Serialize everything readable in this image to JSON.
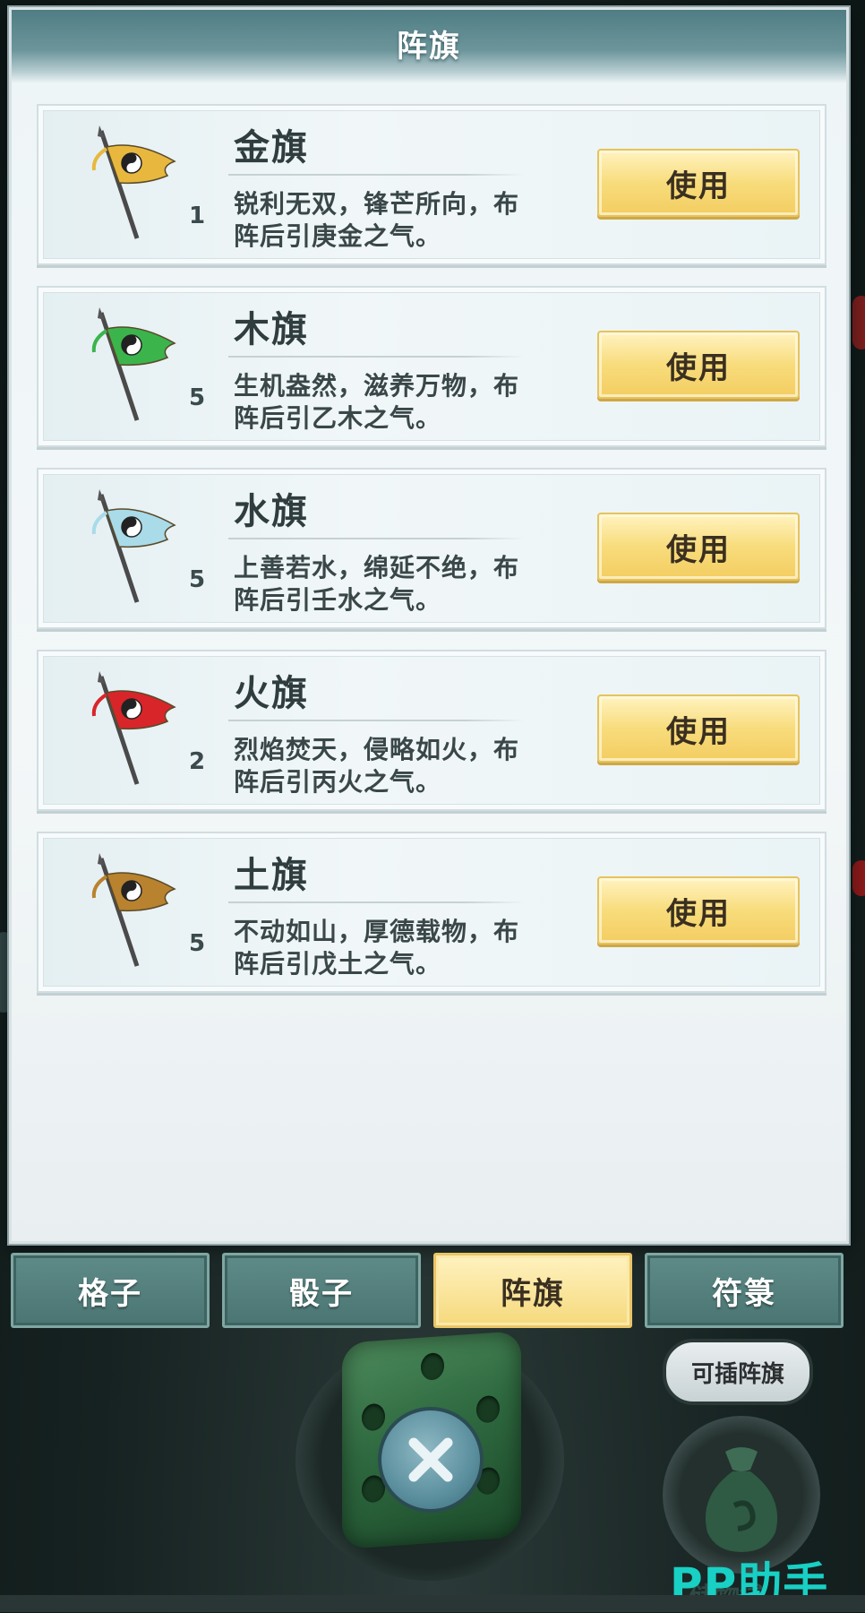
{
  "panel": {
    "title": "阵旗"
  },
  "items": [
    {
      "name": "金旗",
      "count": "1",
      "desc": "锐利无双，锋芒所向，布阵后引庚金之气。",
      "button": "使用",
      "color": "#e8b83e",
      "icon": "gold-flag-icon"
    },
    {
      "name": "木旗",
      "count": "5",
      "desc": "生机盎然，滋养万物，布阵后引乙木之气。",
      "button": "使用",
      "color": "#3bb44c",
      "icon": "wood-flag-icon"
    },
    {
      "name": "水旗",
      "count": "5",
      "desc": "上善若水，绵延不绝，布阵后引壬水之气。",
      "button": "使用",
      "color": "#a9dbe8",
      "icon": "water-flag-icon"
    },
    {
      "name": "火旗",
      "count": "2",
      "desc": "烈焰焚天，侵略如火，布阵后引丙火之气。",
      "button": "使用",
      "color": "#d8252a",
      "icon": "fire-flag-icon"
    },
    {
      "name": "土旗",
      "count": "5",
      "desc": "不动如山，厚德载物，布阵后引戊土之气。",
      "button": "使用",
      "color": "#b9822e",
      "icon": "earth-flag-icon"
    }
  ],
  "tabs": [
    {
      "label": "格子",
      "active": false
    },
    {
      "label": "骰子",
      "active": false
    },
    {
      "label": "阵旗",
      "active": true
    },
    {
      "label": "符箓",
      "active": false
    }
  ],
  "hint_bubble": "可插阵旗",
  "bag_label": "储物袋",
  "watermark": "PP助手"
}
